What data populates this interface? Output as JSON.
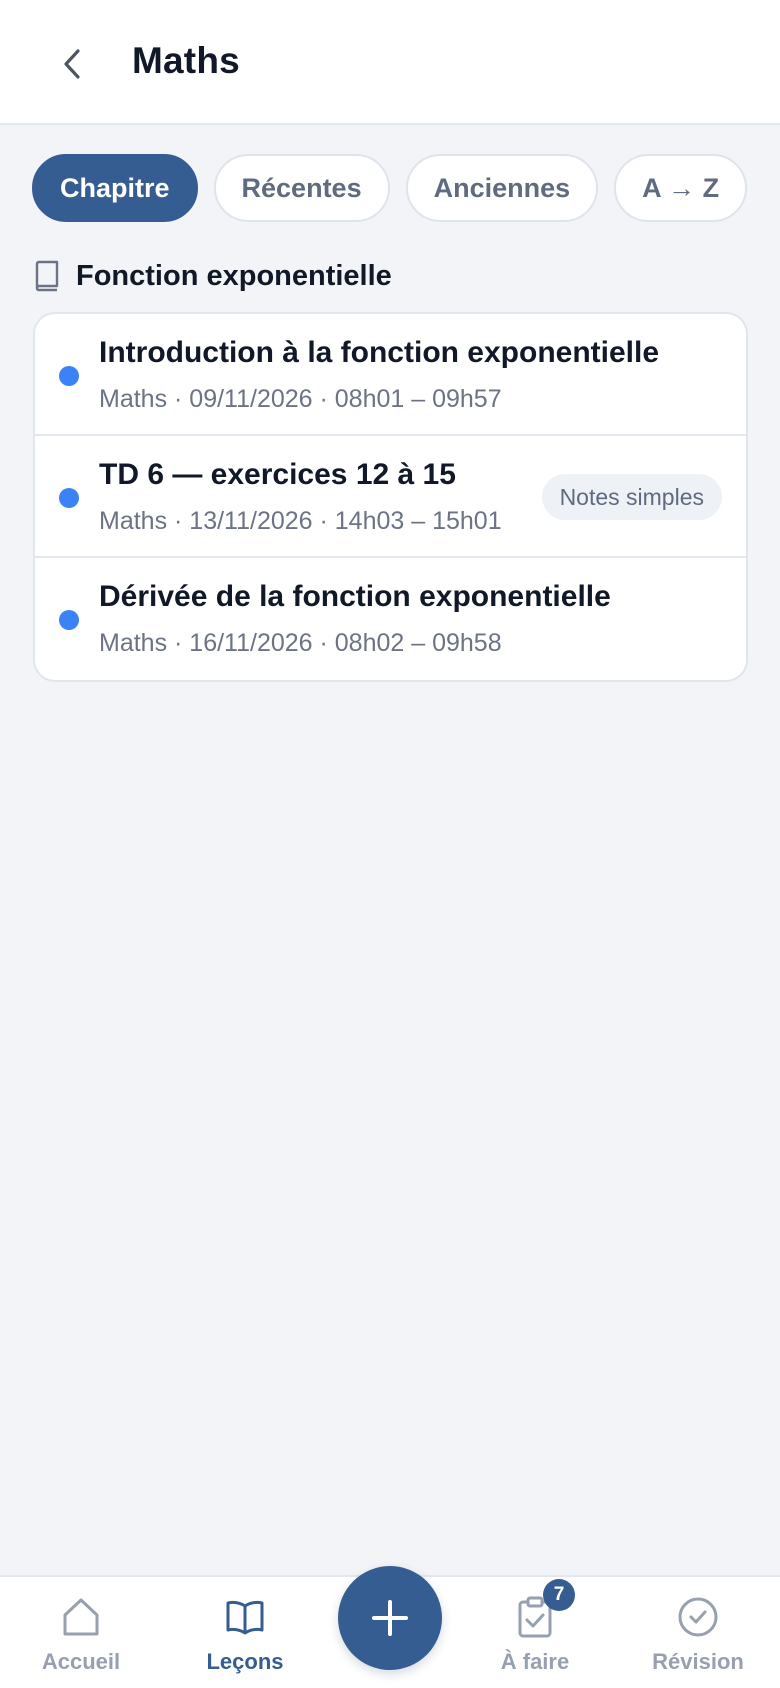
{
  "header": {
    "title": "Maths",
    "back_icon": "chevron-left-icon"
  },
  "filters": [
    {
      "label": "Chapitre",
      "active": true
    },
    {
      "label": "Récentes",
      "active": false
    },
    {
      "label": "Anciennes",
      "active": false
    },
    {
      "label": "A → Z",
      "active": false
    }
  ],
  "section": {
    "icon": "book-icon",
    "title": "Fonction exponentielle"
  },
  "lessons": [
    {
      "title": "Introduction à la fonction exponentielle",
      "meta": "Maths · 09/11/2026 · 08h01 – 09h57",
      "badge": ""
    },
    {
      "title": "TD 6 — exercices 12 à 15",
      "meta": "Maths · 13/11/2026 · 14h03 – 15h01",
      "badge": "Notes simples"
    },
    {
      "title": "Dérivée de la fonction exponentielle",
      "meta": "Maths · 16/11/2026 · 08h02 – 09h58",
      "badge": ""
    }
  ],
  "nav": {
    "home": {
      "label": "Accueil",
      "icon": "home-icon"
    },
    "lessons": {
      "label": "Leçons",
      "icon": "open-book-icon"
    },
    "add": {
      "icon": "plus-icon"
    },
    "todo": {
      "label": "À faire",
      "icon": "clipboard-check-icon",
      "badge": "7"
    },
    "review": {
      "label": "Révision",
      "icon": "check-circle-icon"
    }
  },
  "colors": {
    "accent": "#355d92",
    "dot": "#3b82f6",
    "background": "#f2f4f8"
  }
}
